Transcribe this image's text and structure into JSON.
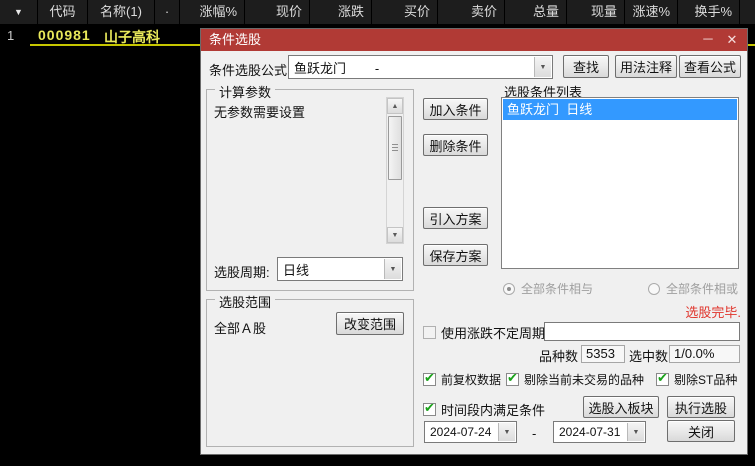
{
  "table": {
    "columns": [
      "▼",
      "代码",
      "名称(1)",
      "·",
      "涨幅%",
      "现价",
      "涨跌",
      "买价",
      "卖价",
      "总量",
      "现量",
      "涨速%",
      "换手%"
    ],
    "row": {
      "index": "1",
      "code": "000981",
      "name": "山子高科"
    }
  },
  "dialog": {
    "title": "条件选股",
    "minimize_label": "－",
    "close_label": "✕",
    "icons": {
      "check": "✔",
      "combo_arrow": "▼",
      "scroll_up": "▲",
      "scroll_down": "▼"
    },
    "formula": {
      "label": "条件选股公式",
      "value": "鱼跃龙门        -",
      "find_button": "查找",
      "usage_button": "用法注释",
      "view_button": "查看公式"
    },
    "params": {
      "group_label": "计算参数",
      "empty_text": "无参数需要设置",
      "period_label": "选股周期:",
      "period_value": "日线"
    },
    "range": {
      "group_label": "选股范围",
      "value": "全部Ａ股",
      "change_button": "改变范围"
    },
    "actions": {
      "add": "加入条件",
      "remove": "删除条件",
      "import": "引入方案",
      "save": "保存方案"
    },
    "conditions": {
      "label": "选股条件列表",
      "items": [
        "鱼跃龙门  日线"
      ],
      "and_radio": "全部条件相与",
      "or_radio": "全部条件相或"
    },
    "status_text": "选股完毕.",
    "options": {
      "irregular_period": "使用涨跌不定周期",
      "irregular_value": "",
      "count_label": "品种数",
      "count_value": "5353",
      "selected_label": "选中数",
      "selected_value": "1/0.0%",
      "forward_adjusted": "前复权数据",
      "exclude_untraded": "剔除当前未交易的品种",
      "exclude_st": "剔除ST品种",
      "time_range": "时间段内满足条件"
    },
    "footer": {
      "to_block_button": "选股入板块",
      "execute_button": "执行选股",
      "close_button": "关闭",
      "date_from": "2024-07-24",
      "date_separator": "-",
      "date_to": "2024-07-31"
    },
    "colors": {
      "titlebar_red": "#b13a35",
      "selection_blue": "#3399ff",
      "status_red": "#e0342b",
      "check_green": "#1aa21a",
      "stock_yellow": "#e8e85a"
    }
  }
}
